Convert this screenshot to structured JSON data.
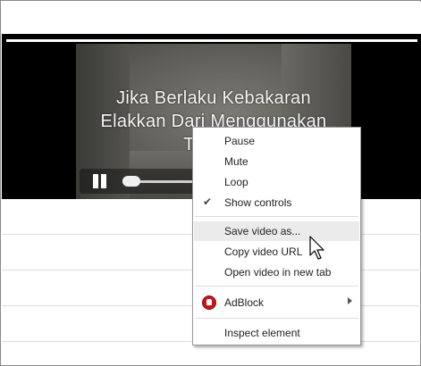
{
  "video": {
    "subtitle_lines": [
      "Jika Berlaku Kebakaran",
      "Elakkan Dari Menggunakan",
      "Tangga"
    ]
  },
  "context_menu": {
    "items": [
      {
        "id": "pause",
        "label": "Pause"
      },
      {
        "id": "mute",
        "label": "Mute"
      },
      {
        "id": "loop",
        "label": "Loop"
      },
      {
        "id": "show_controls",
        "label": "Show controls",
        "checked": true
      },
      {
        "id": "save_video_as",
        "label": "Save video as...",
        "highlighted": true
      },
      {
        "id": "copy_video_url",
        "label": "Copy video URL"
      },
      {
        "id": "open_video_new_tab",
        "label": "Open video in new tab"
      },
      {
        "id": "adblock",
        "label": "AdBlock",
        "icon": "adblock-icon",
        "has_submenu": true
      },
      {
        "id": "inspect_element",
        "label": "Inspect element"
      }
    ],
    "check_glyph": "✔"
  },
  "colors": {
    "adblock_red": "#c4171c",
    "menu_hover": "#ebebeb"
  }
}
